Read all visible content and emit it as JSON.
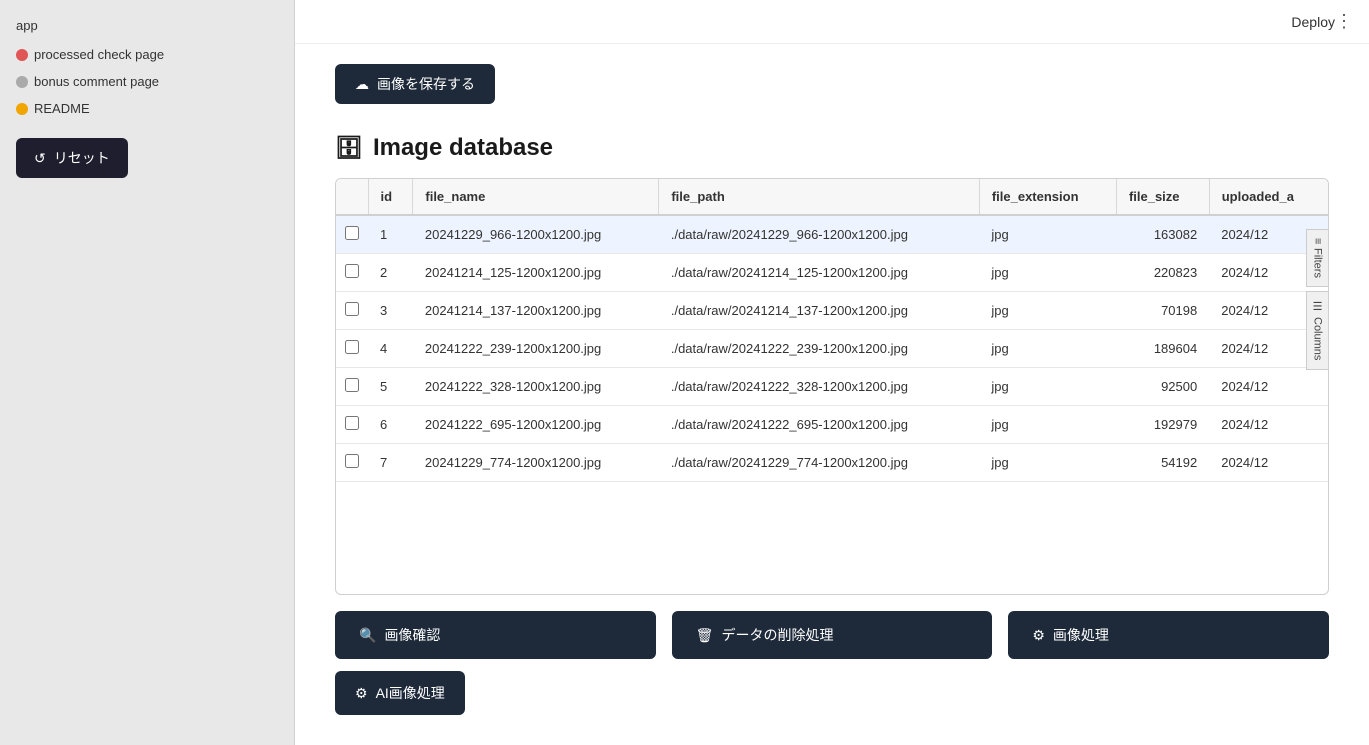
{
  "sidebar": {
    "app_label": "app",
    "items": [
      {
        "id": "processed-check",
        "label": "processed check page",
        "icon_type": "red"
      },
      {
        "id": "bonus-comment",
        "label": "bonus comment page",
        "icon_type": "gray"
      },
      {
        "id": "readme",
        "label": "README",
        "icon_type": "yellow"
      }
    ],
    "reset_button": "リセット"
  },
  "topbar": {
    "deploy_label": "Deploy",
    "kebab": "⋮"
  },
  "main": {
    "save_button": "画像を保存する",
    "section_title": "Image database",
    "table": {
      "columns": [
        "id",
        "file_name",
        "file_path",
        "file_extension",
        "file_size",
        "uploaded_a"
      ],
      "rows": [
        {
          "id": 1,
          "file_name": "20241229_966-1200x1200.jpg",
          "file_path": "./data/raw/20241229_966-1200x1200.jpg",
          "file_extension": "jpg",
          "file_size": 163082,
          "uploaded_at": "2024/12"
        },
        {
          "id": 2,
          "file_name": "20241214_125-1200x1200.jpg",
          "file_path": "./data/raw/20241214_125-1200x1200.jpg",
          "file_extension": "jpg",
          "file_size": 220823,
          "uploaded_at": "2024/12"
        },
        {
          "id": 3,
          "file_name": "20241214_137-1200x1200.jpg",
          "file_path": "./data/raw/20241214_137-1200x1200.jpg",
          "file_extension": "jpg",
          "file_size": 70198,
          "uploaded_at": "2024/12"
        },
        {
          "id": 4,
          "file_name": "20241222_239-1200x1200.jpg",
          "file_path": "./data/raw/20241222_239-1200x1200.jpg",
          "file_extension": "jpg",
          "file_size": 189604,
          "uploaded_at": "2024/12"
        },
        {
          "id": 5,
          "file_name": "20241222_328-1200x1200.jpg",
          "file_path": "./data/raw/20241222_328-1200x1200.jpg",
          "file_extension": "jpg",
          "file_size": 92500,
          "uploaded_at": "2024/12"
        },
        {
          "id": 6,
          "file_name": "20241222_695-1200x1200.jpg",
          "file_path": "./data/raw/20241222_695-1200x1200.jpg",
          "file_extension": "jpg",
          "file_size": 192979,
          "uploaded_at": "2024/12"
        },
        {
          "id": 7,
          "file_name": "20241229_774-1200x1200.jpg",
          "file_path": "./data/raw/20241229_774-1200x1200.jpg",
          "file_extension": "jpg",
          "file_size": 54192,
          "uploaded_at": "2024/12"
        }
      ],
      "side_buttons": {
        "filters": "Filters",
        "columns": "Columns"
      }
    },
    "bottom_buttons": {
      "image_check": "画像確認",
      "delete_data": "データの削除処理",
      "image_process": "画像処理",
      "ai_image_process": "AI画像処理"
    }
  },
  "icons": {
    "cloud_upload": "☁",
    "database": "🗄",
    "search": "🔍",
    "trash": "🗑",
    "gear": "⚙",
    "refresh": "↺"
  }
}
